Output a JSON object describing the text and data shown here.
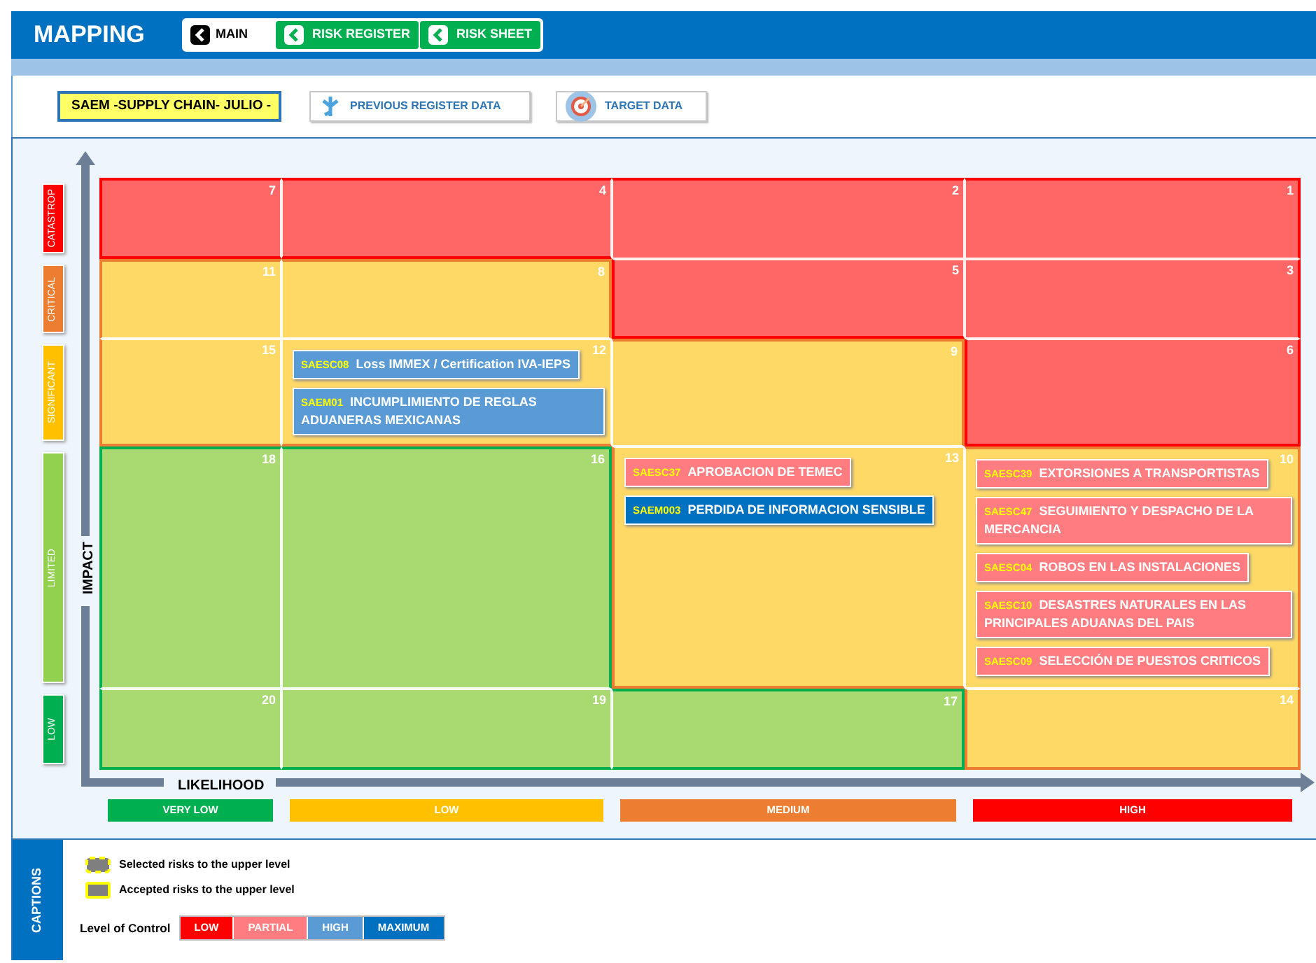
{
  "header": {
    "title": "MAPPING",
    "nav": [
      {
        "label": "MAIN",
        "kind": "main",
        "selected": true
      },
      {
        "label": "RISK REGISTER",
        "kind": "sheet",
        "selected": false
      },
      {
        "label": "RISK SHEET",
        "kind": "sheet",
        "selected": false
      }
    ]
  },
  "toolbar": {
    "register_field": {
      "value": "SAEM -SUPPLY CHAIN- JULIO -"
    },
    "buttons": [
      {
        "label": "PREVIOUS REGISTER DATA",
        "kind": "previous"
      },
      {
        "label": "TARGET DATA",
        "kind": "target"
      }
    ]
  },
  "matrix": {
    "impact_axis": "IMPACT",
    "likelihood_axis": "LIKELIHOOD",
    "impact_levels": [
      {
        "label": "CATASTROP",
        "color": "#ff0000"
      },
      {
        "label": "CRITICAL",
        "color": "#ed7d31"
      },
      {
        "label": "SIGNIFICANT",
        "color": "#ffc000"
      },
      {
        "label": "LIMITED",
        "color": "#92d050"
      },
      {
        "label": "LOW",
        "color": "#00b050"
      }
    ],
    "rows": [
      {
        "cells": [
          {
            "number": "7",
            "color": "#ff6666"
          },
          {
            "number": "4",
            "color": "#ff6666"
          },
          {
            "number": "2",
            "color": "#ff6666"
          },
          {
            "number": "1",
            "color": "#ff6666"
          }
        ]
      },
      {
        "cells": [
          {
            "number": "11",
            "color": "#ffd966"
          },
          {
            "number": "8",
            "color": "#ffd966"
          },
          {
            "number": "5",
            "color": "#ff6666"
          },
          {
            "number": "3",
            "color": "#ff6666"
          }
        ]
      },
      {
        "cells": [
          {
            "number": "15",
            "color": "#ffd966"
          },
          {
            "number": "12",
            "color": "#ffd966",
            "risks": [
              {
                "code": "SAESC08",
                "title": "Loss IMMEX / Certification IVA-IEPS",
                "color": "#5b9bd5"
              },
              {
                "code": "SAEM01",
                "title": "INCUMPLIMIENTO DE REGLAS ADUANERAS MEXICANAS",
                "color": "#5b9bd5"
              }
            ]
          },
          {
            "number": "9",
            "color": "#ffd966"
          },
          {
            "number": "6",
            "color": "#ff6666"
          }
        ]
      },
      {
        "cells": [
          {
            "number": "18",
            "color": "#a9d971"
          },
          {
            "number": "16",
            "color": "#a9d971"
          },
          {
            "number": "13",
            "color": "#ffd966",
            "risks": [
              {
                "code": "SAESC37",
                "title": "APROBACION DE TEMEC",
                "color": "#ff7c80"
              },
              {
                "code": "SAEM003",
                "title": "PERDIDA DE INFORMACION SENSIBLE",
                "color": "#0070c0"
              }
            ]
          },
          {
            "number": "10",
            "color": "#ffd966",
            "risks": [
              {
                "code": "SAESC39",
                "title": "EXTORSIONES A TRANSPORTISTAS",
                "color": "#ff7c80"
              },
              {
                "code": "SAESC47",
                "title": "SEGUIMIENTO Y DESPACHO DE LA MERCANCIA",
                "color": "#ff7c80"
              },
              {
                "code": "SAESC04",
                "title": "ROBOS EN LAS INSTALACIONES",
                "color": "#ff7c80"
              },
              {
                "code": "SAESC10",
                "title": "DESASTRES NATURALES EN LAS PRINCIPALES ADUANAS DEL PAIS",
                "color": "#ff7c80"
              },
              {
                "code": "SAESC09",
                "title": "SELECCIÓN DE PUESTOS CRITICOS",
                "color": "#ff7c80"
              }
            ]
          }
        ]
      },
      {
        "cells": [
          {
            "number": "20",
            "color": "#a9d971"
          },
          {
            "number": "19",
            "color": "#a9d971"
          },
          {
            "number": "17",
            "color": "#a9d971"
          },
          {
            "number": "14",
            "color": "#ffd966"
          }
        ]
      }
    ],
    "likelihood_levels": [
      {
        "label": "VERY LOW",
        "color": "#00b050"
      },
      {
        "label": "LOW",
        "color": "#ffc000"
      },
      {
        "label": "MEDIUM",
        "color": "#ed7d31"
      },
      {
        "label": "HIGH",
        "color": "#ff0000"
      }
    ]
  },
  "captions": {
    "title": "CAPTIONS",
    "legend": [
      {
        "label": "Selected risks to the upper level",
        "kind": "selected"
      },
      {
        "label": "Accepted risks to the upper level",
        "kind": "accepted"
      }
    ],
    "control_label": "Level of Control",
    "control_levels": [
      {
        "label": "LOW",
        "color": "#ff0000"
      },
      {
        "label": "PARTIAL",
        "color": "#ff7c80"
      },
      {
        "label": "HIGH",
        "color": "#5b9bd5"
      },
      {
        "label": "MAXIMUM",
        "color": "#0070c0"
      }
    ]
  }
}
